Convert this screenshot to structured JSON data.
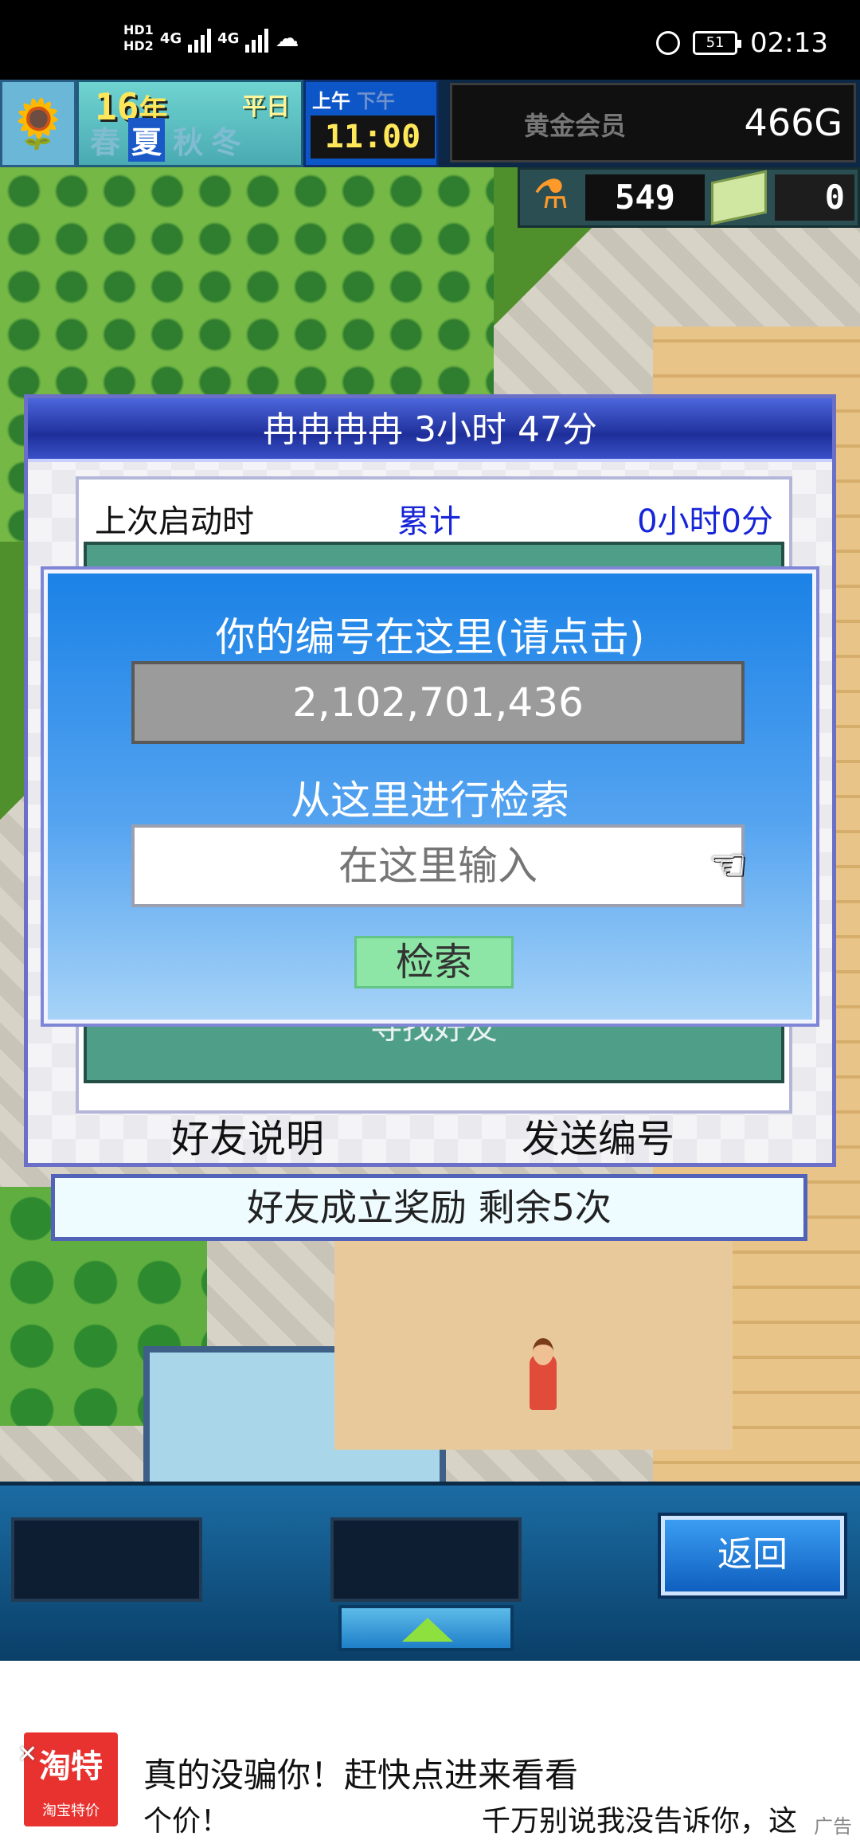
{
  "statusbar": {
    "hd1": "HD1",
    "hd2": "HD2",
    "net1": "4G",
    "net2": "4G",
    "battery": "51",
    "time": "02:13"
  },
  "hud": {
    "year_num": "16",
    "year_unit": "年",
    "week": "平日",
    "seasons": [
      "春",
      "夏",
      "秋",
      "冬"
    ],
    "active_season_index": 1,
    "am": "上午",
    "pm": "下午",
    "time": "11:00",
    "member": "黄金会员",
    "money": "466G",
    "research_points": "549",
    "tickets": "0"
  },
  "panel": {
    "title": "冉冉冉冉  3小时 47分",
    "last_launch_label": "上次启动时",
    "total_label": "累计",
    "total_value": "0小时0分",
    "hidden_button": "寻找好友",
    "friend_help": "好友说明",
    "send_id": "发送编号",
    "reward": "好友成立奖励  剩余5次"
  },
  "dialog": {
    "id_label": "你的编号在这里(请点击)",
    "id_value": "2,102,701,436",
    "search_label": "从这里进行检索",
    "search_placeholder": "在这里输入",
    "search_button": "检索"
  },
  "bottombar": {
    "back_button": "返回"
  },
  "ad": {
    "logo_main": "淘特",
    "logo_sub": "淘宝特价",
    "title": "真的没骗你！赶快点进来看看",
    "sub1": "个价！",
    "sub2": "千万别说我没告诉你，这",
    "tag": "广告"
  },
  "colors": {
    "panel_header": "#1e2f9a",
    "dialog_blue": "#1b82e6",
    "search_green": "#8de6a6",
    "accent_blue_text": "#1725d8"
  }
}
